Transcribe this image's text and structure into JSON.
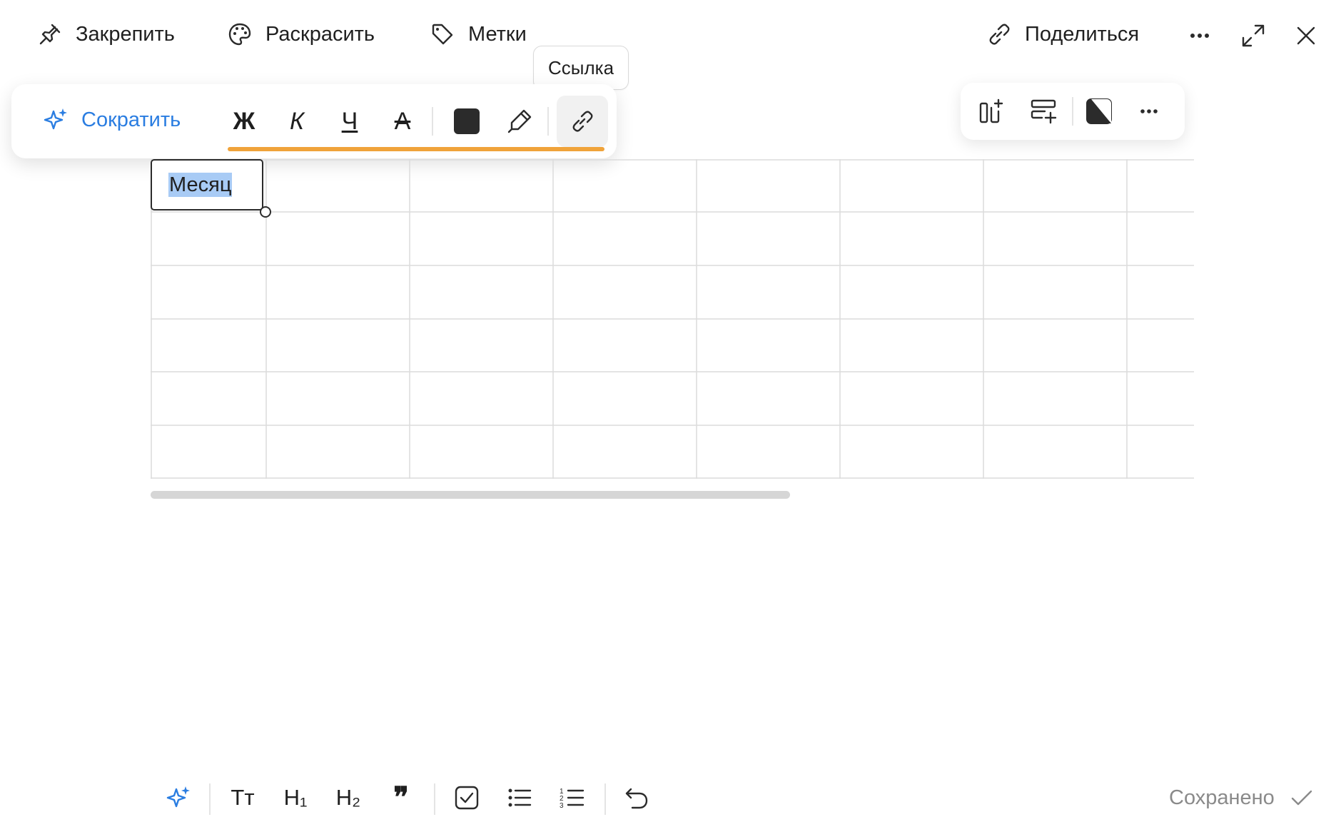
{
  "topbar": {
    "pin_label": "Закрепить",
    "color_label": "Раскрасить",
    "tags_label": "Метки",
    "share_label": "Поделиться"
  },
  "tooltip": {
    "text": "Ссылка"
  },
  "format_toolbar": {
    "ai_shorten_label": "Сократить",
    "bold_glyph": "Ж",
    "italic_glyph": "К",
    "underline_glyph": "Ч",
    "strike_glyph": "А",
    "text_color": "#2b2b2b",
    "accent_color": "#2a7de1",
    "active_underline_color": "#f0a33a"
  },
  "table": {
    "selected_cell_text": "Месяц",
    "columns": 8,
    "rows": 6
  },
  "bottom_toolbar": {
    "text_size_label": "Тт",
    "h1_label": "H₁",
    "h2_label": "H₂",
    "quote_label": "❞"
  },
  "status": {
    "saved_label": "Сохранено"
  }
}
